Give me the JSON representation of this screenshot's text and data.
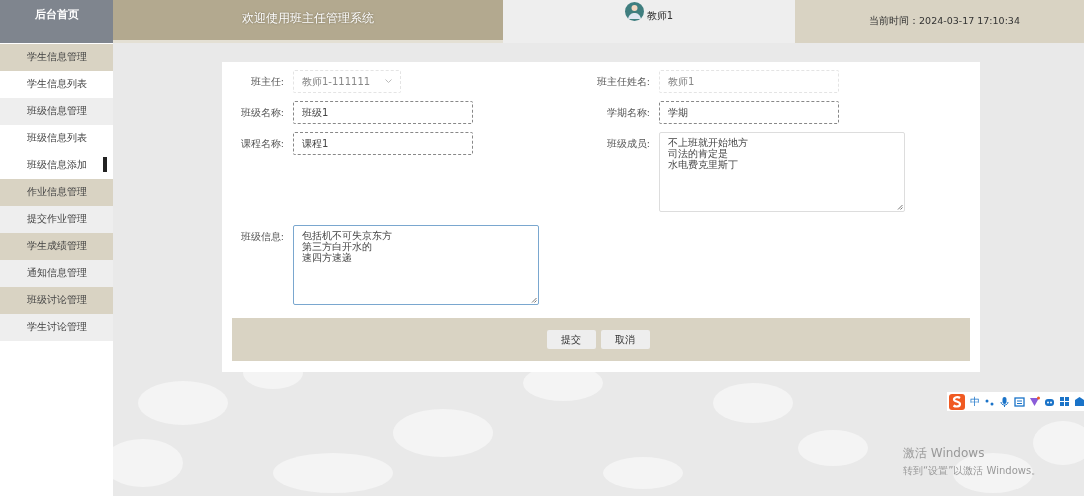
{
  "header": {
    "logo": "后台首页",
    "title": "欢迎使用班主任管理系统",
    "user": "教师1",
    "time": "当前时间：2024-03-17 17:10:34"
  },
  "sidebar": {
    "items": [
      {
        "label": "学生信息管理",
        "kind": "header",
        "selected": false
      },
      {
        "label": "学生信息列表",
        "kind": "sub",
        "selected": false
      },
      {
        "label": "班级信息管理",
        "kind": "plain",
        "selected": false
      },
      {
        "label": "班级信息列表",
        "kind": "sub",
        "selected": false
      },
      {
        "label": "班级信息添加",
        "kind": "sub",
        "selected": true
      },
      {
        "label": "作业信息管理",
        "kind": "header",
        "selected": false
      },
      {
        "label": "提交作业管理",
        "kind": "plain",
        "selected": false
      },
      {
        "label": "学生成绩管理",
        "kind": "header",
        "selected": false
      },
      {
        "label": "通知信息管理",
        "kind": "plain",
        "selected": false
      },
      {
        "label": "班级讨论管理",
        "kind": "header",
        "selected": false
      },
      {
        "label": "学生讨论管理",
        "kind": "plain",
        "selected": false
      }
    ]
  },
  "form": {
    "left_fields": [
      {
        "label": "班主任:",
        "kind": "select",
        "value": "教师1-111111",
        "disabled": true,
        "focused": false
      },
      {
        "label": "班级名称:",
        "kind": "input",
        "value": "班级1",
        "disabled": false,
        "focused": false
      },
      {
        "label": "课程名称:",
        "kind": "input",
        "value": "课程1",
        "disabled": false,
        "focused": false
      },
      {
        "label": "班级信息:",
        "kind": "textarea",
        "lines": [
          "包括机不可失京东方",
          "第三方白开水的",
          "速四方速递"
        ],
        "disabled": false,
        "focused": true
      }
    ],
    "right_fields": [
      {
        "label": "班主任姓名:",
        "kind": "input",
        "value": "教师1",
        "disabled": true,
        "focused": false
      },
      {
        "label": "学期名称:",
        "kind": "input",
        "value": "学期",
        "disabled": false,
        "focused": false
      },
      {
        "label": "班级成员:",
        "kind": "textarea",
        "lines": [
          "不上班就开始地方",
          "司法的肯定是",
          "水电费克里斯丁"
        ],
        "disabled": false,
        "focused": false
      }
    ],
    "buttons": [
      "提交",
      "取消"
    ]
  },
  "ime_toolbar": {
    "label": "中"
  },
  "windows_notice": {
    "title": "激活 Windows",
    "subtitle": "转到“设置”以激活 Windows。"
  }
}
